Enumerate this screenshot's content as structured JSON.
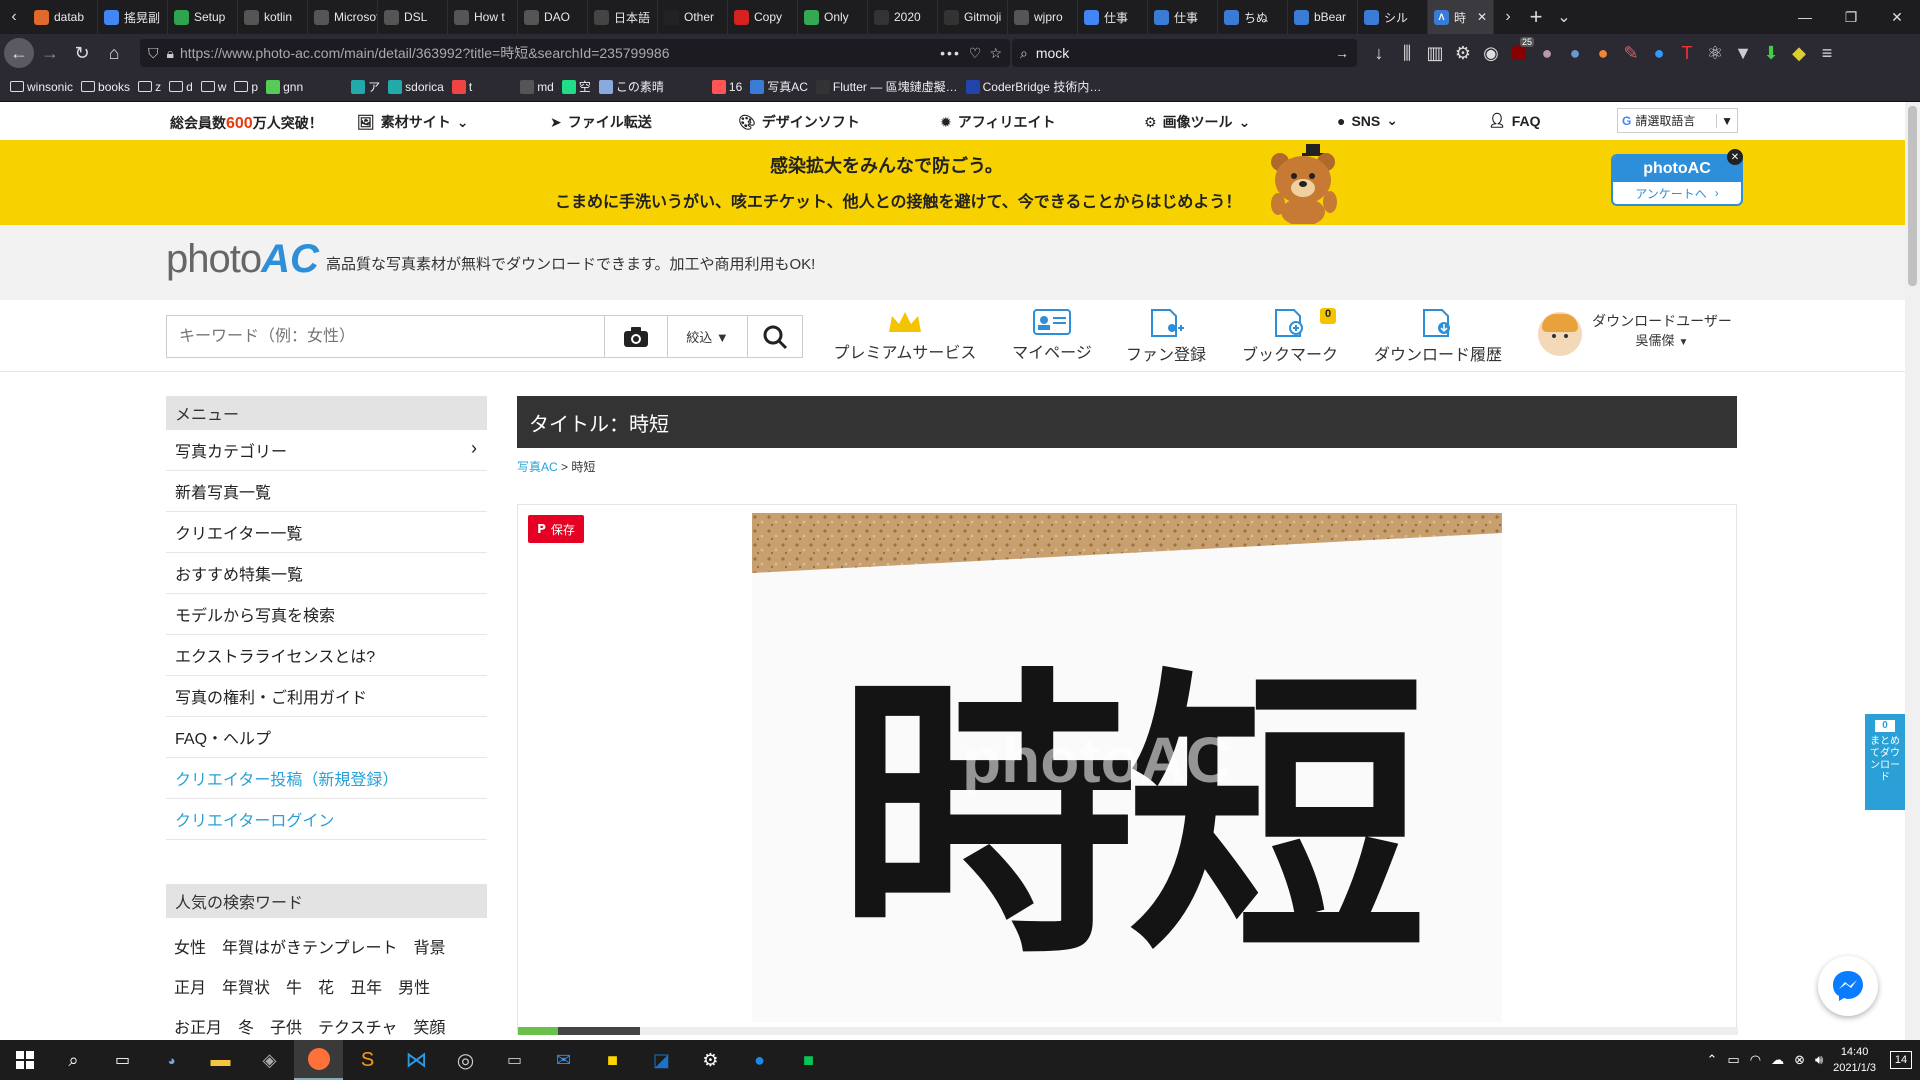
{
  "browser": {
    "tabs": [
      {
        "label": "datab",
        "color": "#e06a2c"
      },
      {
        "label": "搖晃副",
        "color": "#4285f4"
      },
      {
        "label": "Setup",
        "color": "#2ea44f"
      },
      {
        "label": "kotlin",
        "color": "#555555"
      },
      {
        "label": "Microsoft",
        "color": "#555555"
      },
      {
        "label": "DSL",
        "color": "#555555"
      },
      {
        "label": "How t",
        "color": "#555555"
      },
      {
        "label": "DAO",
        "color": "#555555"
      },
      {
        "label": "日本語",
        "color": "#444444"
      },
      {
        "label": "Other",
        "color": "#222222"
      },
      {
        "label": "Copy",
        "color": "#d6211f"
      },
      {
        "label": "Only",
        "color": "#34a853"
      },
      {
        "label": "2020",
        "color": "#333333"
      },
      {
        "label": "Gitmoji",
        "color": "#333333"
      },
      {
        "label": "wjpro",
        "color": "#555555"
      },
      {
        "label": "仕事",
        "color": "#4285f4"
      },
      {
        "label": "仕事",
        "color": "#3a7bd5"
      },
      {
        "label": "ちぬ",
        "color": "#3a7bd5"
      },
      {
        "label": "bBear",
        "color": "#3a7bd5"
      },
      {
        "label": "シル",
        "color": "#3a7bd5"
      }
    ],
    "active_tab": {
      "label": "時",
      "close": "✕"
    },
    "url": "https://www.photo-ac.com/main/detail/363992?title=時短&searchId=235799986",
    "search_value": "mock",
    "bookmarks": [
      "winsonic",
      "books",
      "z",
      "d",
      "w",
      "p",
      "gnn",
      "ア",
      "sdorica",
      "t",
      "md",
      "空",
      "この素晴",
      "16",
      "写真AC",
      "Flutter — 區塊鏈虛擬…",
      "CoderBridge 技術内…"
    ],
    "badge": "25"
  },
  "site": {
    "topnav": {
      "members_prefix": "総会員数",
      "members_count": "600",
      "members_suffix": "万人突破！",
      "items": [
        "素材サイト",
        "ファイル転送",
        "デザインソフト",
        "アフィリエイト",
        "画像ツール",
        "SNS",
        "FAQ"
      ],
      "translate_label": "請選取語言"
    },
    "banner": {
      "line1": "感染拡大をみんなで防ごう。",
      "line2": "こまめに手洗いうがい、咳エチケット、他人との接触を避けて、今できることからはじめよう！",
      "button_brand": "photoAC",
      "button_label": "アンケートへ"
    },
    "logo": {
      "text_photo": "photo",
      "text_ac": "AC",
      "tagline": "高品質な写真素材が無料でダウンロードできます。加工や商用利用もOK!"
    },
    "search": {
      "placeholder": "キーワード（例：女性）",
      "filter_label": "絞込 ▼",
      "nav": [
        "プレミアムサービス",
        "マイページ",
        "ファン登録",
        "ブックマーク",
        "ダウンロード履歴"
      ],
      "bookmark_count": "0",
      "user_role": "ダウンロードユーザー",
      "user_name": "吳儒傑"
    },
    "sidebar": {
      "menu_title": "メニュー",
      "menu_items": [
        "写真カテゴリー",
        "新着写真一覧",
        "クリエイター一覧",
        "おすすめ特集一覧",
        "モデルから写真を検索",
        "エクストラライセンスとは?",
        "写真の権利・ご利用ガイド",
        "FAQ・ヘルプ"
      ],
      "creator_items": [
        "クリエイター投稿（新規登録）",
        "クリエイターログイン"
      ],
      "popular_title": "人気の検索ワード",
      "popular_words": [
        [
          "女性",
          "年賀はがきテンプレート",
          "背景"
        ],
        [
          "正月",
          "年賀状",
          "牛",
          "花",
          "丑年",
          "男性"
        ],
        [
          "お正月",
          "冬",
          "子供",
          "テクスチャ",
          "笑顔"
        ]
      ]
    },
    "content": {
      "title": "タイトル：時短",
      "breadcrumb_root": "写真AC",
      "breadcrumb_sep": ">",
      "breadcrumb_current": "時短",
      "save_label": "保存",
      "photo_text": "時短",
      "watermark": "photoAC"
    },
    "float": {
      "count": "0",
      "label": "まとめてダウンロード"
    }
  },
  "taskbar": {
    "time": "14:40",
    "date": "2021/1/3",
    "notify_count": "14"
  }
}
